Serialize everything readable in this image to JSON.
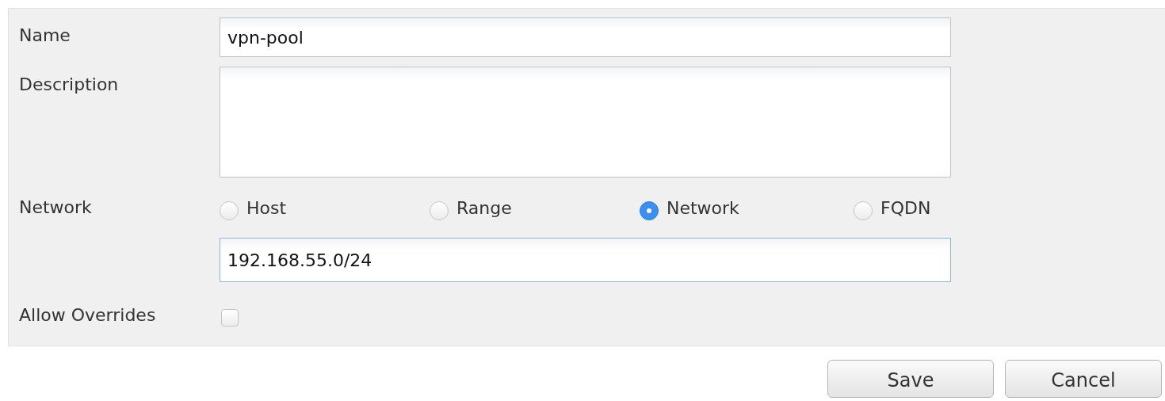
{
  "form": {
    "fields": [
      {
        "kind": "text",
        "label": "Name",
        "value": "vpn-pool",
        "focused": false
      },
      {
        "kind": "textarea",
        "label": "Description",
        "focused": false
      },
      {
        "kind": "radio",
        "label": "Network",
        "options": [
          {
            "label": "Host",
            "selected": false
          },
          {
            "label": "Range",
            "selected": false
          },
          {
            "label": "Network",
            "selected": true
          },
          {
            "label": "FQDN",
            "selected": false
          }
        ]
      },
      {
        "kind": "text",
        "value": "192.168.55.0/24",
        "focused": true
      },
      {
        "kind": "checkbox",
        "label": "Allow Overrides",
        "checked": false
      }
    ]
  },
  "buttons": [
    {
      "label": "Save"
    },
    {
      "label": "Cancel"
    }
  ]
}
